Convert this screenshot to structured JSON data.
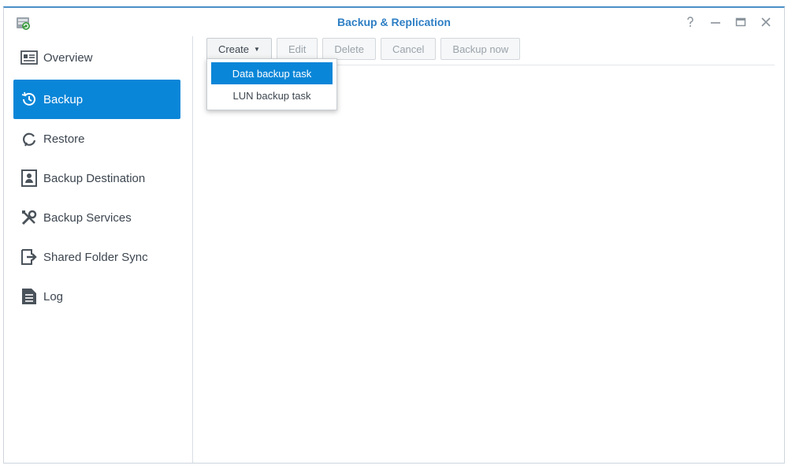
{
  "window": {
    "title": "Backup & Replication",
    "app_icon": "backup-replication-app-icon",
    "controls": [
      {
        "name": "help-icon",
        "glyph": "?"
      },
      {
        "name": "minimize-icon",
        "glyph": "—"
      },
      {
        "name": "maximize-icon",
        "glyph": "□"
      },
      {
        "name": "close-icon",
        "glyph": "✕"
      }
    ]
  },
  "sidebar": {
    "items": [
      {
        "label": "Overview",
        "icon": "overview-icon",
        "active": false
      },
      {
        "label": "Backup",
        "icon": "backup-clock-icon",
        "active": true
      },
      {
        "label": "Restore",
        "icon": "restore-icon",
        "active": false
      },
      {
        "label": "Backup Destination",
        "icon": "backup-destination-icon",
        "active": false
      },
      {
        "label": "Backup Services",
        "icon": "wrench-screwdriver-icon",
        "active": false
      },
      {
        "label": "Shared Folder Sync",
        "icon": "folder-sync-icon",
        "active": false
      },
      {
        "label": "Log",
        "icon": "log-icon",
        "active": false
      }
    ]
  },
  "toolbar": {
    "create_label": "Create",
    "edit_label": "Edit",
    "delete_label": "Delete",
    "cancel_label": "Cancel",
    "backup_now_label": "Backup now"
  },
  "create_menu": {
    "items": [
      {
        "label": "Data backup task",
        "highlighted": true
      },
      {
        "label": "LUN backup task",
        "highlighted": false
      }
    ]
  },
  "colors": {
    "accent": "#0a86d8",
    "title": "#2e7fc4"
  }
}
